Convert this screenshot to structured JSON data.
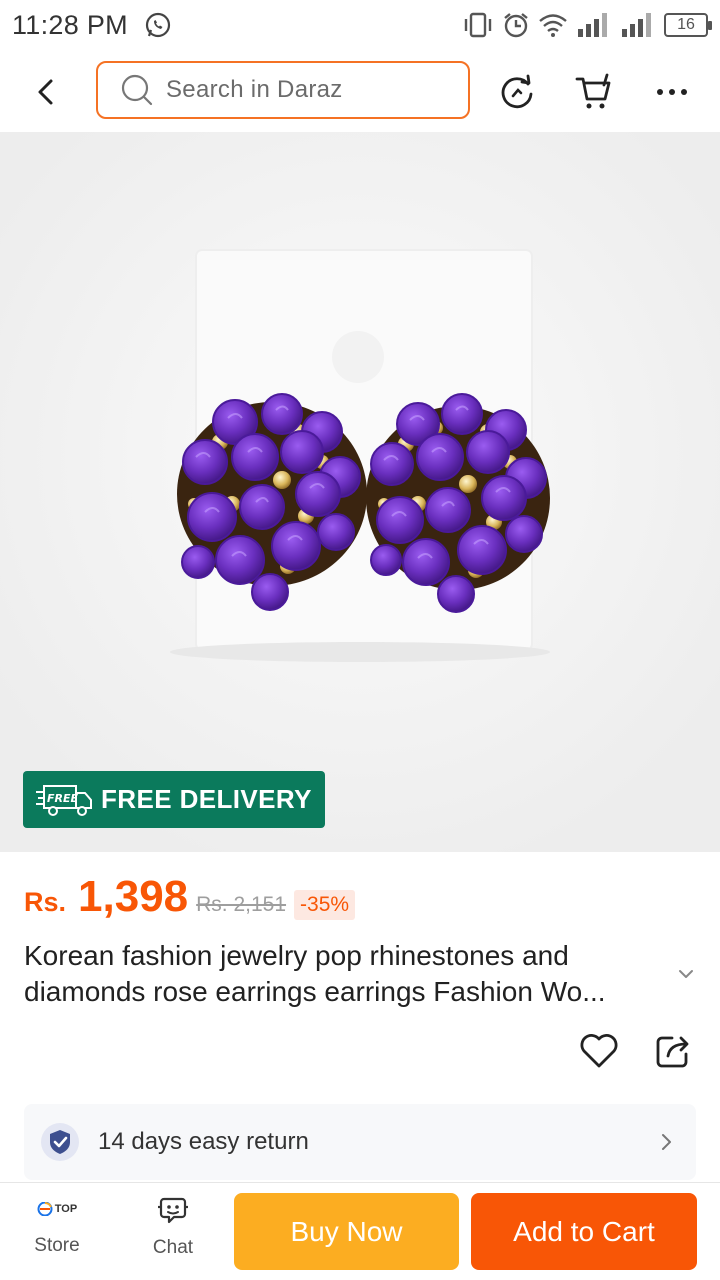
{
  "status_bar": {
    "time": "11:28 PM",
    "battery": "16",
    "icons": [
      "whatsapp-icon",
      "vibrate-icon",
      "alarm-icon",
      "wifi-icon",
      "signal-icon",
      "signal-icon",
      "battery-icon"
    ]
  },
  "top_nav": {
    "search_placeholder": "Search in Daraz",
    "icons": [
      "back-icon",
      "search-icon",
      "refresh-icon",
      "cart-icon",
      "more-icon"
    ]
  },
  "product": {
    "image_alt": "purple rose flower stud earrings",
    "badge": "FREE DELIVERY",
    "badge_icon_text": "FREE",
    "price_currency": "Rs.",
    "price": "1,398",
    "price_old": "Rs. 2,151",
    "discount": "-35%",
    "title_line1": "Korean fashion jewelry pop rhinestones and",
    "title_line2": "diamonds rose earrings earrings Fashion Wo..."
  },
  "return_policy": {
    "text": "14 days easy return"
  },
  "bottom_bar": {
    "store_logo_text": "TOP",
    "store_label": "Store",
    "chat_label": "Chat",
    "buy_now": "Buy Now",
    "add_to_cart": "Add to Cart"
  },
  "colors": {
    "accent": "#f85606",
    "buy_now": "#fcad21",
    "free_delivery": "#0b7a5c",
    "earring": "#6a2fbf"
  }
}
